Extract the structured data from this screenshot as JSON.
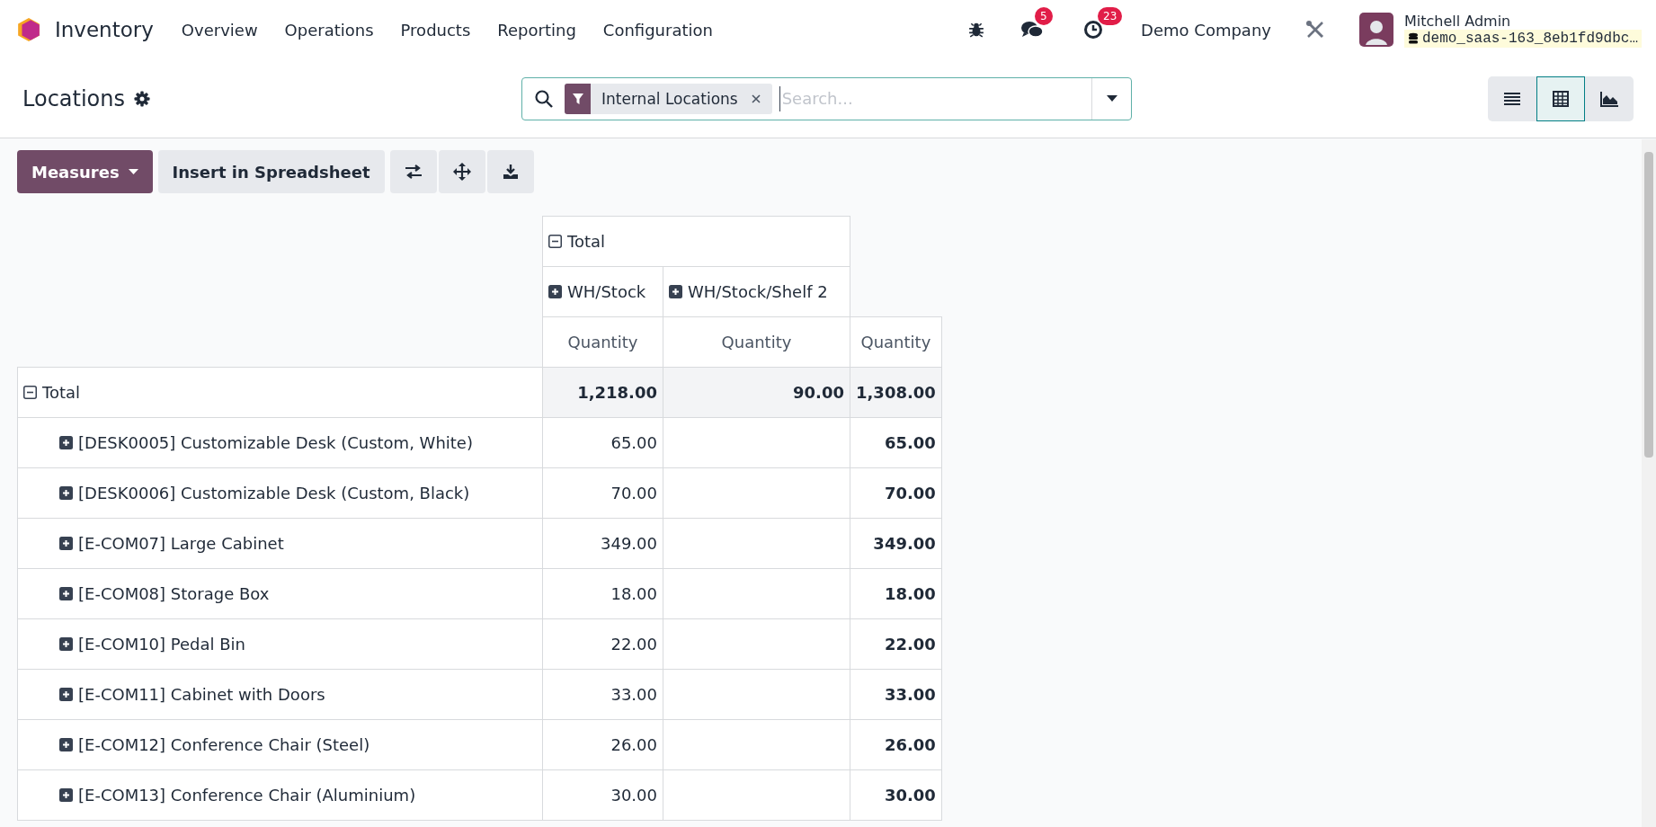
{
  "app": {
    "name": "Inventory"
  },
  "menu": [
    "Overview",
    "Operations",
    "Products",
    "Reporting",
    "Configuration"
  ],
  "systray": {
    "messages_badge": "5",
    "activities_badge": "23",
    "company": "Demo Company",
    "user": {
      "name": "Mitchell Admin",
      "database": "demo_saas-163_8eb1fd9dbc…"
    }
  },
  "control_panel": {
    "title": "Locations",
    "search": {
      "facets": [
        {
          "label": "Internal Locations"
        }
      ],
      "placeholder": "Search..."
    },
    "views": [
      {
        "kind": "list",
        "selected": false
      },
      {
        "kind": "pivot",
        "selected": true
      },
      {
        "kind": "graph",
        "selected": false
      }
    ]
  },
  "toolbar": {
    "measures_button": "Measures",
    "insert_button": "Insert in Spreadsheet"
  },
  "pivot": {
    "column_header": {
      "label": "Total",
      "expanded": true,
      "children": [
        {
          "label": "WH/Stock",
          "expanded": false
        },
        {
          "label": "WH/Stock/Shelf 2",
          "expanded": false
        }
      ]
    },
    "measures": [
      "Quantity",
      "Quantity",
      "Quantity"
    ],
    "rows": [
      {
        "label": "Total",
        "expanded": true,
        "wh_stock": "1,218.00",
        "wh_stock_shelf_2": "90.00",
        "total": "1,308.00",
        "children": [
          {
            "label": "[DESK0005] Customizable Desk (Custom, White)",
            "expanded": false,
            "wh_stock": "65.00",
            "total": "65.00"
          },
          {
            "label": "[DESK0006] Customizable Desk (Custom, Black)",
            "expanded": false,
            "wh_stock": "70.00",
            "total": "70.00"
          },
          {
            "label": "[E-COM07] Large Cabinet",
            "expanded": false,
            "wh_stock": "349.00",
            "total": "349.00"
          },
          {
            "label": "[E-COM08] Storage Box",
            "expanded": false,
            "wh_stock": "18.00",
            "total": "18.00"
          },
          {
            "label": "[E-COM10] Pedal Bin",
            "expanded": false,
            "wh_stock": "22.00",
            "total": "22.00"
          },
          {
            "label": "[E-COM11] Cabinet with Doors",
            "expanded": false,
            "wh_stock": "33.00",
            "total": "33.00"
          },
          {
            "label": "[E-COM12] Conference Chair (Steel)",
            "expanded": false,
            "wh_stock": "26.00",
            "total": "26.00"
          },
          {
            "label": "[E-COM13] Conference Chair (Aluminium)",
            "expanded": false,
            "wh_stock": "30.00",
            "total": "30.00"
          }
        ]
      }
    ]
  }
}
